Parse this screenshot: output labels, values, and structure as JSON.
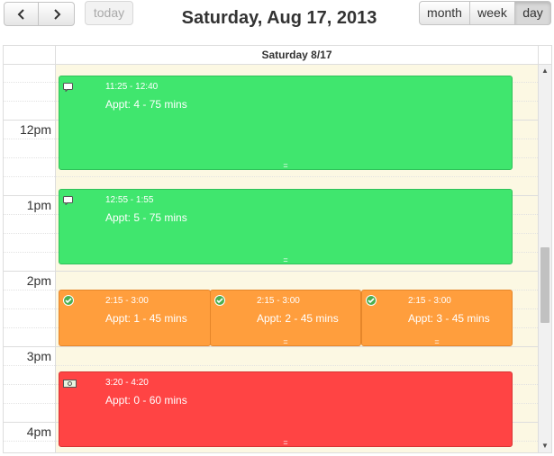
{
  "toolbar": {
    "prev_icon": "chevron-left-icon",
    "next_icon": "chevron-right-icon",
    "today_label": "today",
    "title": "Saturday, Aug 17, 2013",
    "views": [
      {
        "label": "month",
        "active": false
      },
      {
        "label": "week",
        "active": false
      },
      {
        "label": "day",
        "active": true
      }
    ]
  },
  "day_header": "Saturday 8/17",
  "hour_labels": [
    "12pm",
    "1pm",
    "2pm",
    "3pm",
    "4pm"
  ],
  "colors": {
    "highlight_bg": "#fcf8e3",
    "green": "#40e66e",
    "orange": "#ff9e3d",
    "red": "#ff4444"
  },
  "events": [
    {
      "time": "11:25 - 12:40",
      "title": "Appt: 4 - 75 mins",
      "color": "green",
      "icon": "comment-icon"
    },
    {
      "time": "12:55 - 1:55",
      "title": "Appt: 5 - 75 mins",
      "color": "green",
      "icon": "comment-icon"
    },
    {
      "time": "2:15 - 3:00",
      "title": "Appt: 1 - 45 mins",
      "color": "orange",
      "icon": "checkmark-icon"
    },
    {
      "time": "2:15 - 3:00",
      "title": "Appt: 2 - 45 mins",
      "color": "orange",
      "icon": "checkmark-icon"
    },
    {
      "time": "2:15 - 3:00",
      "title": "Appt: 3 - 45 mins",
      "color": "orange",
      "icon": "checkmark-icon"
    },
    {
      "time": "3:20 - 4:20",
      "title": "Appt: 0 - 60 mins",
      "color": "red",
      "icon": "money-icon"
    }
  ],
  "resize_handle": "="
}
